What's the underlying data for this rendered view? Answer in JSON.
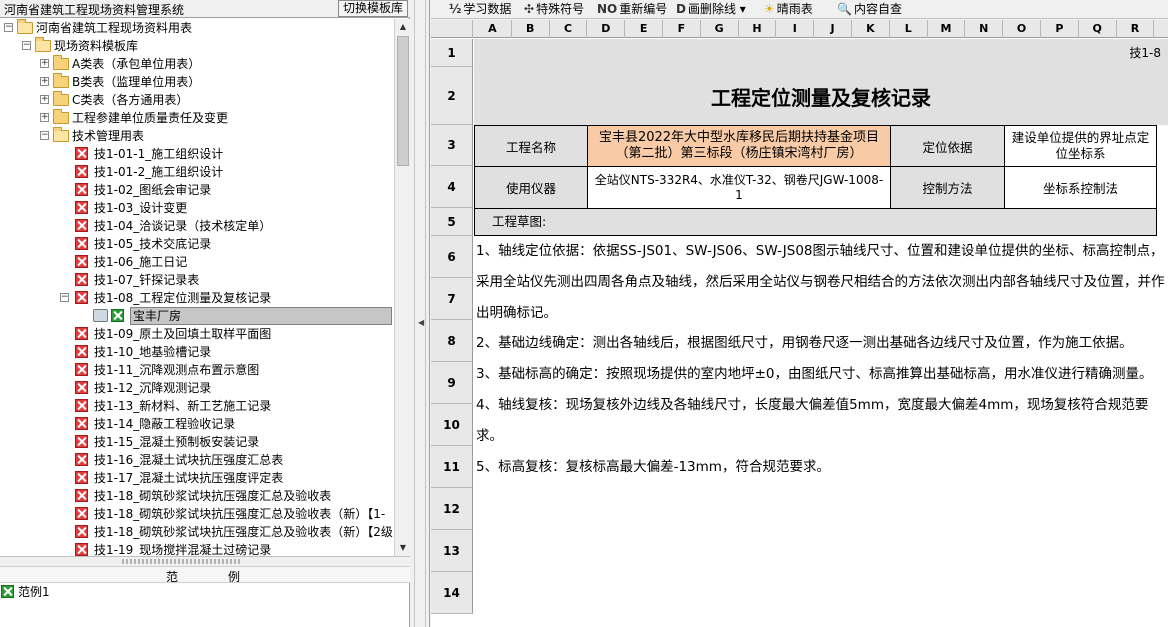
{
  "left": {
    "title": "河南省建筑工程现场资料管理系统",
    "switch_button": "切换模板库",
    "tree": [
      {
        "label": "河南省建筑工程现场资料用表",
        "level": 0,
        "icon": "folder-open",
        "expander": "minus"
      },
      {
        "label": "现场资料模板库",
        "level": 1,
        "icon": "folder-open",
        "expander": "minus"
      },
      {
        "label": "A类表（承包单位用表）",
        "level": 2,
        "icon": "folder",
        "expander": "plus"
      },
      {
        "label": "B类表（监理单位用表）",
        "level": 2,
        "icon": "folder",
        "expander": "plus"
      },
      {
        "label": "C类表（各方通用表）",
        "level": 2,
        "icon": "folder",
        "expander": "plus"
      },
      {
        "label": "工程参建单位质量责任及变更",
        "level": 2,
        "icon": "folder",
        "expander": "plus"
      },
      {
        "label": "技术管理用表",
        "level": 2,
        "icon": "folder-open",
        "expander": "minus"
      },
      {
        "label": "技1-01-1_施工组织设计",
        "level": 3,
        "icon": "x-file"
      },
      {
        "label": "技1-01-2_施工组织设计",
        "level": 3,
        "icon": "x-file"
      },
      {
        "label": "技1-02_图纸会审记录",
        "level": 3,
        "icon": "x-file"
      },
      {
        "label": "技1-03_设计变更",
        "level": 3,
        "icon": "x-file"
      },
      {
        "label": "技1-04_洽谈记录（技术核定单）",
        "level": 3,
        "icon": "x-file"
      },
      {
        "label": "技1-05_技术交底记录",
        "level": 3,
        "icon": "x-file"
      },
      {
        "label": "技1-06_施工日记",
        "level": 3,
        "icon": "x-file"
      },
      {
        "label": "技1-07_钎探记录表",
        "level": 3,
        "icon": "x-file"
      },
      {
        "label": "技1-08_工程定位测量及复核记录",
        "level": 3,
        "icon": "x-file",
        "expander": "minus"
      },
      {
        "label": "宝丰厂房",
        "level": 4,
        "icon": "doc-green",
        "selected": true
      },
      {
        "label": "技1-09_原土及回填土取样平面图",
        "level": 3,
        "icon": "x-file"
      },
      {
        "label": "技1-10_地基验槽记录",
        "level": 3,
        "icon": "x-file"
      },
      {
        "label": "技1-11_沉降观测点布置示意图",
        "level": 3,
        "icon": "x-file"
      },
      {
        "label": "技1-12_沉降观测记录",
        "level": 3,
        "icon": "x-file"
      },
      {
        "label": "技1-13_新材料、新工艺施工记录",
        "level": 3,
        "icon": "x-file"
      },
      {
        "label": "技1-14_隐蔽工程验收记录",
        "level": 3,
        "icon": "x-file"
      },
      {
        "label": "技1-15_混凝土预制板安装记录",
        "level": 3,
        "icon": "x-file"
      },
      {
        "label": "技1-16_混凝土试块抗压强度汇总表",
        "level": 3,
        "icon": "x-file"
      },
      {
        "label": "技1-17_混凝土试块抗压强度评定表",
        "level": 3,
        "icon": "x-file"
      },
      {
        "label": "技1-18_砌筑砂浆试块抗压强度汇总及验收表",
        "level": 3,
        "icon": "x-file"
      },
      {
        "label": "技1-18_砌筑砂浆试块抗压强度汇总及验收表（新）【1-",
        "level": 3,
        "icon": "x-file"
      },
      {
        "label": "技1-18_砌筑砂浆试块抗压强度汇总及验收表（新）【2级",
        "level": 3,
        "icon": "x-file"
      },
      {
        "label": "技1-19_现场搅拌混凝土过磅记录",
        "level": 3,
        "icon": "x-file"
      }
    ],
    "list_header": {
      "col1": "范",
      "col2": "例"
    },
    "list_items": [
      {
        "label": "范例1"
      }
    ]
  },
  "toolbar": {
    "items": [
      {
        "icon": "subscript-icon",
        "glyph": "½",
        "label": "学习数据"
      },
      {
        "icon": "special-char-icon",
        "glyph": "✣",
        "label": "特殊符号"
      },
      {
        "icon": "renumber-icon",
        "glyph": "NO",
        "label": "重新编号"
      },
      {
        "icon": "strike-icon",
        "glyph": "D",
        "label": "画删除线 ▾"
      },
      {
        "icon": "sun-icon",
        "glyph": "☀",
        "label": "晴雨表"
      },
      {
        "icon": "magnifier-icon",
        "glyph": "🔍",
        "label": "内容自查"
      }
    ]
  },
  "sheet": {
    "columns": [
      "A",
      "B",
      "C",
      "D",
      "E",
      "F",
      "G",
      "H",
      "I",
      "J",
      "K",
      "L",
      "M",
      "N",
      "O",
      "P",
      "Q",
      "R"
    ],
    "rows": [
      "1",
      "2",
      "3",
      "4",
      "5",
      "6",
      "7",
      "8",
      "9",
      "10",
      "11",
      "12",
      "13",
      "14"
    ],
    "form_code": "技1-8",
    "title": "工程定位测量及复核记录",
    "project_name_label": "工程名称",
    "project_name_value": "宝丰县2022年大中型水库移民后期扶持基金项目（第二批）第三标段（杨庄镇宋湾村厂房）",
    "basis_label": "定位依据",
    "basis_value": "建设单位提供的界址点定位坐标系",
    "instrument_label": "使用仪器",
    "instrument_value": "全站仪NTS-332R4、水准仪T-32、钢卷尺JGW-1008-1",
    "control_label": "控制方法",
    "control_value": "坐标系控制法",
    "sketch_label": "工程草图:",
    "paragraphs": [
      "1、轴线定位依据：依据SS-JS01、SW-JS06、SW-JS08图示轴线尺寸、位置和建设单位提供的坐标、标高控制点，采用全站仪先测出四周各角点及轴线，然后采用全站仪与钢卷尺相结合的方法依次测出内部各轴线尺寸及位置，并作出明确标记。",
      "2、基础边线确定：测出各轴线后，根据图纸尺寸，用钢卷尺逐一测出基础各边线尺寸及位置，作为施工依据。",
      "3、基础标高的确定：按照现场提供的室内地坪±0，由图纸尺寸、标高推算出基础标高，用水准仪进行精确测量。",
      "4、轴线复核：现场复核外边线及各轴线尺寸，长度最大偏差值5mm，宽度最大偏差4mm，现场复核符合规范要求。",
      "5、标高复核：复核标高最大偏差-13mm，符合规范要求。"
    ]
  }
}
